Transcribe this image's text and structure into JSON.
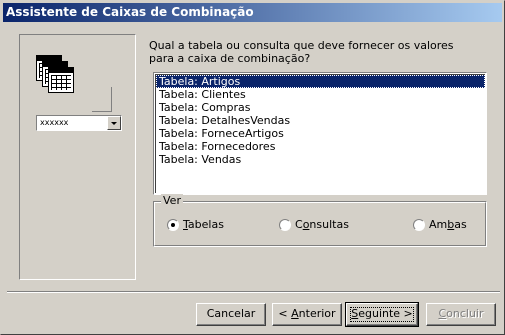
{
  "window": {
    "title": "Assistente de Caixas de Combinação"
  },
  "illustration": {
    "combo_sample_text": "xxxxxx"
  },
  "question": "Qual a tabela ou consulta que deve fornecer os valores para a caixa de combinação?",
  "list": {
    "selected_index": 0,
    "items": [
      "Tabela: Artigos",
      "Tabela: Clientes",
      "Tabela: Compras",
      "Tabela: DetalhesVendas",
      "Tabela: ForneceArtigos",
      "Tabela: Fornecedores",
      "Tabela: Vendas"
    ]
  },
  "view_group": {
    "label": "Ver",
    "options": [
      {
        "accel": "T",
        "rest": "abelas",
        "checked": true
      },
      {
        "prefix": "C",
        "accel": "o",
        "rest": "nsultas",
        "checked": false
      },
      {
        "prefix": "Am",
        "accel": "b",
        "rest": "as",
        "checked": false
      }
    ]
  },
  "buttons": {
    "cancel": "Cancelar",
    "back_prefix": "< ",
    "back_accel": "A",
    "back_rest": "nterior",
    "next_accel": "S",
    "next_rest": "eguinte >",
    "finish_accel": "C",
    "finish_rest": "oncluir"
  },
  "colors": {
    "title_gradient_start": "#0a246a",
    "title_gradient_end": "#a6caf0",
    "selection": "#0a246a",
    "face": "#d4d0c8"
  }
}
